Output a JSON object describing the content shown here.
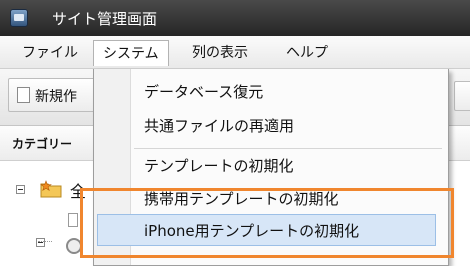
{
  "window": {
    "title": "サイト管理画面",
    "app_icon": "app-icon"
  },
  "menubar": {
    "items": [
      {
        "label": "ファイル"
      },
      {
        "label": "システム",
        "active": true
      },
      {
        "label": "列の表示"
      },
      {
        "label": "ヘルプ"
      }
    ]
  },
  "toolbar": {
    "new_label": "新規作",
    "new_icon": "document-icon"
  },
  "panel": {
    "title": "カテゴリー"
  },
  "tree": {
    "root_label": "全",
    "root_icon": "folder-star-icon",
    "toggle_icon": "tree-toggle-icon"
  },
  "dropdown": {
    "items": [
      {
        "label": "データベース復元"
      },
      {
        "label": "共通ファイルの再適用"
      },
      {
        "label": "テンプレートの初期化"
      },
      {
        "label": "携帯用テンプレートの初期化"
      },
      {
        "label": "iPhone用テンプレートの初期化",
        "highlighted": true
      }
    ]
  },
  "colors": {
    "highlight_border": "#f0862e",
    "hover_background": "#d7e6f7",
    "titlebar": "#2f2f2f"
  }
}
